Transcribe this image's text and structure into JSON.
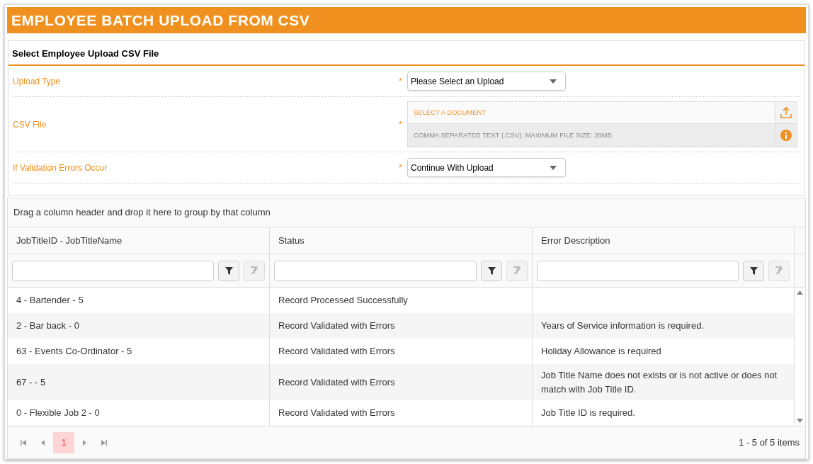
{
  "title": "EMPLOYEE BATCH UPLOAD FROM CSV",
  "panel": {
    "title": "Select Employee Upload CSV File",
    "fields": [
      {
        "kind": "select",
        "label": "Upload Type",
        "required_mark": "*",
        "value": "Please Select an Upload"
      },
      {
        "kind": "file",
        "label": "CSV File",
        "required_mark": "*",
        "placeholder": "SELECT A DOCUMENT",
        "hint": "COMMA SEPARATED TEXT (.CSV). MAXIMUM FILE SIZE: 20MB"
      },
      {
        "kind": "select",
        "label": "If Validation Errors Occur",
        "required_mark": "*",
        "value": "Continue With Upload"
      }
    ]
  },
  "grid": {
    "group_hint": "Drag a column header and drop it here to group by that column",
    "columns": [
      "JobTitleID - JobTitleName",
      "Status",
      "Error Description"
    ],
    "rows": [
      [
        "4 - Bartender - 5",
        "Record Processed Successfully",
        ""
      ],
      [
        "2 - Bar back - 0",
        "Record Validated with Errors",
        "Years of Service information is required."
      ],
      [
        "63 - Events Co-Ordinator - 5",
        "Record Validated with Errors",
        "Holiday Allowance is required"
      ],
      [
        "67 - - 5",
        "Record Validated with Errors",
        "Job Title Name does not exists or is not active or does not match with Job Title ID."
      ],
      [
        "0 - Flexible Job 2 - 0",
        "Record Validated with Errors",
        "Job Title ID is required."
      ]
    ],
    "pages": [
      {
        "label": "1",
        "selected": true
      }
    ],
    "summary": "1 - 5 of 5 items"
  }
}
